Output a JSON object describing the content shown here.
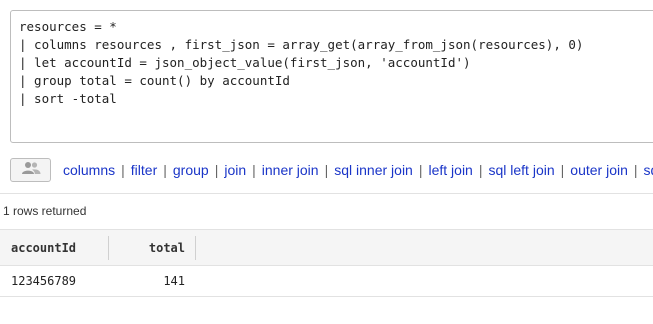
{
  "editor": {
    "lines": [
      "resources = *",
      "| columns resources , first_json = array_get(array_from_json(resources), 0)",
      "| let accountId = json_object_value(first_json, 'accountId')",
      "| group total = count() by accountId",
      "| sort -total"
    ]
  },
  "toolbar": {
    "people_icon": "people-icon",
    "commands": [
      "columns",
      "filter",
      "group",
      "join",
      "inner join",
      "sql inner join",
      "left join",
      "sql left join",
      "outer join",
      "sql"
    ]
  },
  "results": {
    "row_count": "1 rows returned",
    "columns": [
      "accountId",
      "total"
    ],
    "rows": [
      [
        "123456789",
        "141"
      ]
    ]
  }
}
